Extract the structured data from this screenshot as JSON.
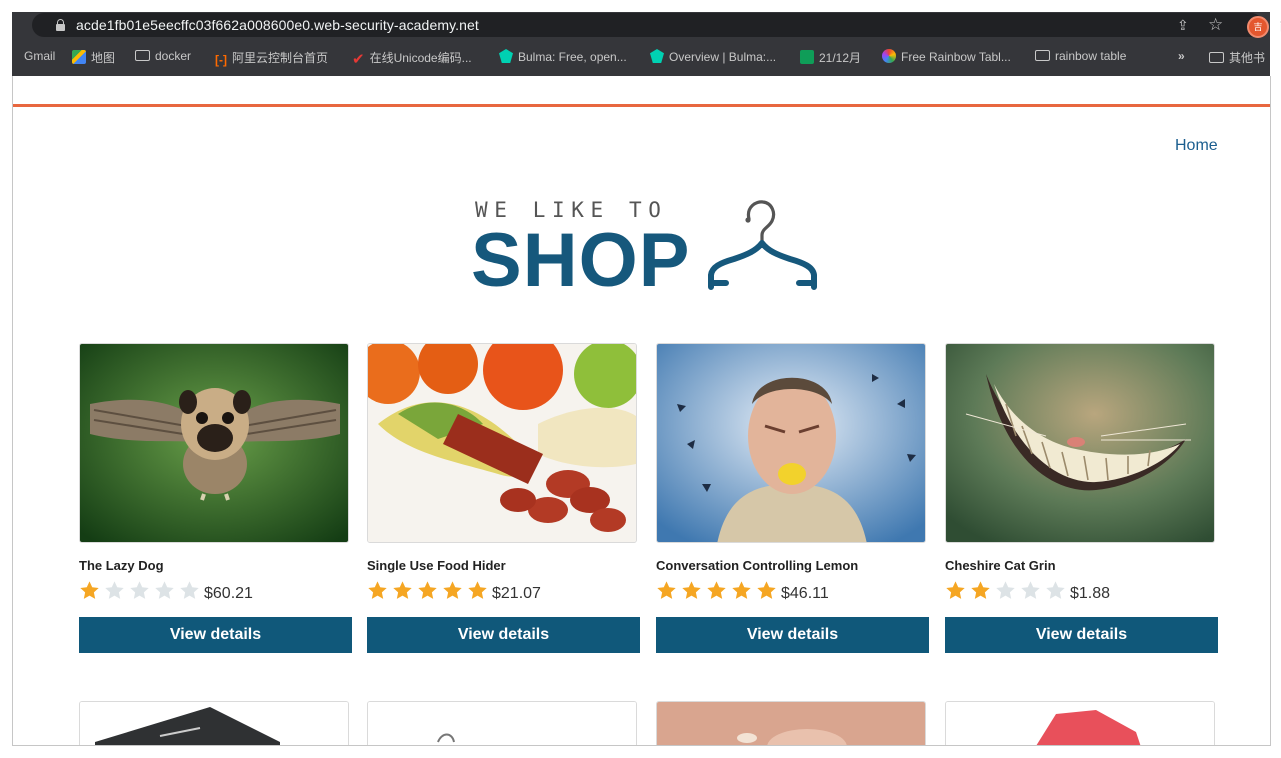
{
  "browser": {
    "url": "acde1fb01e5eecffc03f662a008600e0.web-security-academy.net",
    "avatar_char": "吉",
    "avatar_extra": "已",
    "bookmarks": [
      {
        "label": "Gmail",
        "icon": "gmail-icon"
      },
      {
        "label": "地图",
        "icon": "maps-icon"
      },
      {
        "label": "docker",
        "icon": "folder-icon"
      },
      {
        "label": "阿里云控制台首页",
        "icon": "aliyun-icon"
      },
      {
        "label": "在线Unicode编码...",
        "icon": "checkmark-icon"
      },
      {
        "label": "Bulma: Free, open...",
        "icon": "bulma-icon"
      },
      {
        "label": "Overview | Bulma:...",
        "icon": "bulma-icon"
      },
      {
        "label": "21/12月",
        "icon": "sheets-icon"
      },
      {
        "label": "Free Rainbow Tabl...",
        "icon": "rainbow-icon"
      },
      {
        "label": "rainbow table",
        "icon": "folder-icon"
      },
      {
        "label": "»",
        "icon": ""
      },
      {
        "label": "其他书",
        "icon": "folder-icon"
      }
    ]
  },
  "nav": {
    "home_label": "Home"
  },
  "logo": {
    "small": "WE LIKE TO",
    "big": "SHOP"
  },
  "colors": {
    "accent": "#e8673f",
    "brand": "#16587c",
    "button": "#10587a",
    "star_on": "#f5a623",
    "star_off": "#dde3e6"
  },
  "products": [
    {
      "name": "The Lazy Dog",
      "rating": 1,
      "price": "$60.21",
      "button": "View details"
    },
    {
      "name": "Single Use Food Hider",
      "rating": 5,
      "price": "$21.07",
      "button": "View details"
    },
    {
      "name": "Conversation Controlling Lemon",
      "rating": 5,
      "price": "$46.11",
      "button": "View details"
    },
    {
      "name": "Cheshire Cat Grin",
      "rating": 2,
      "price": "$1.88",
      "button": "View details"
    }
  ]
}
